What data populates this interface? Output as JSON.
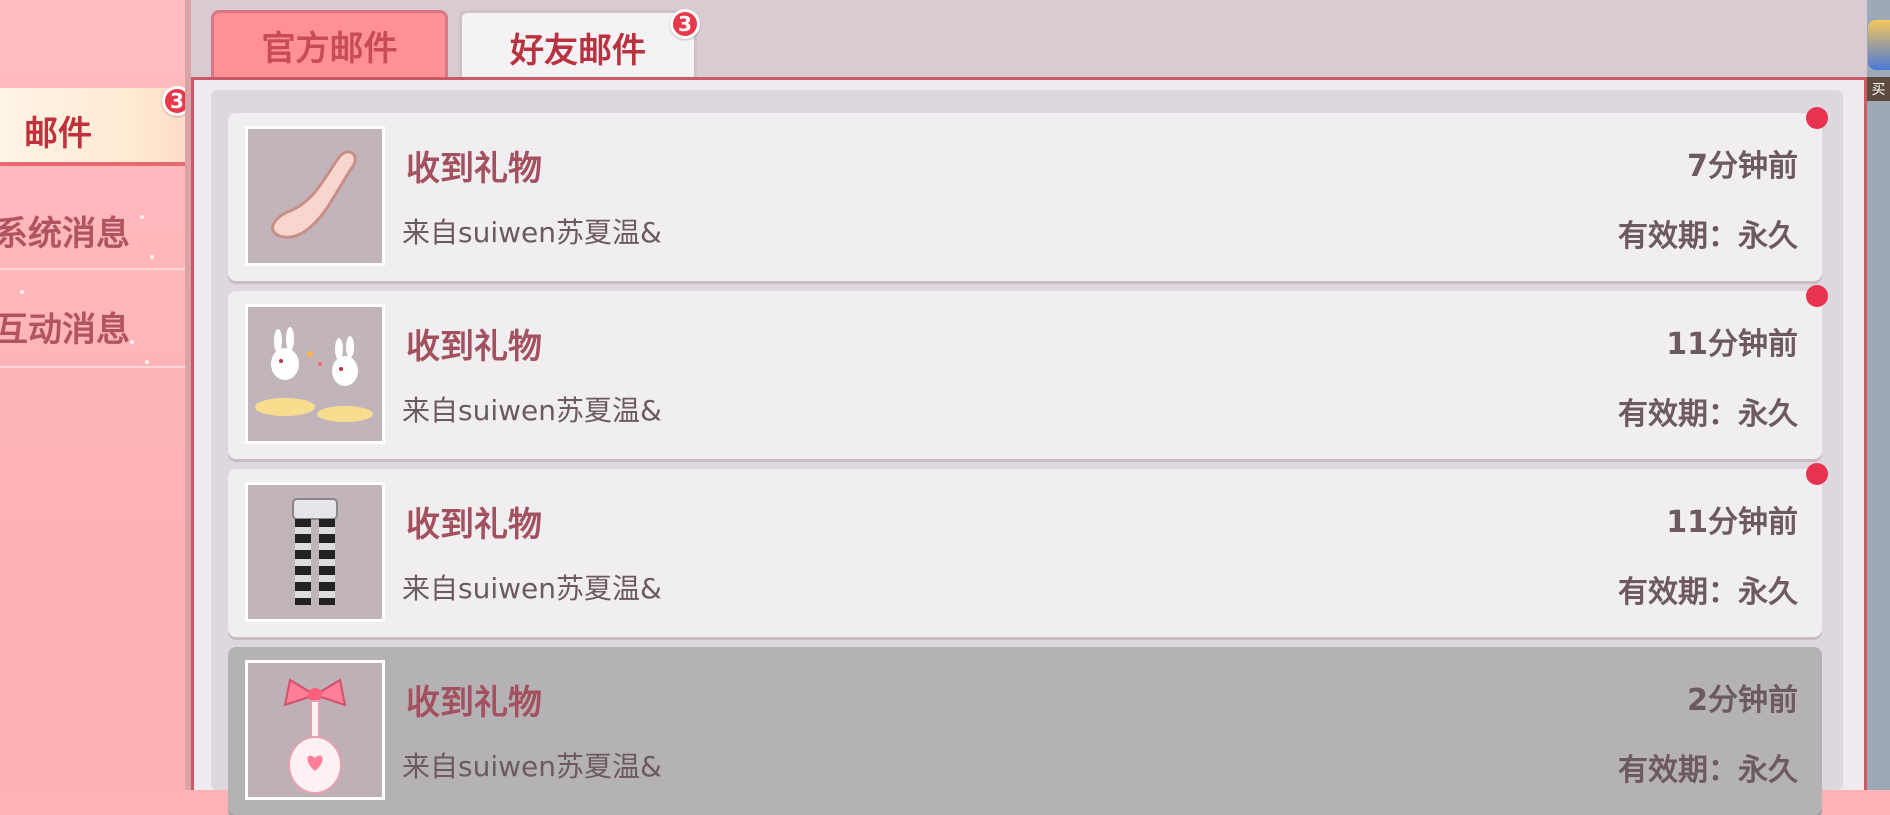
{
  "sidebar": {
    "items": [
      {
        "label": "邮件",
        "active": true,
        "badge": "3"
      },
      {
        "label": "系统消息",
        "active": false
      },
      {
        "label": "互动消息",
        "active": false
      }
    ]
  },
  "tabs": [
    {
      "label": "官方邮件",
      "active": false
    },
    {
      "label": "好友邮件",
      "active": true,
      "badge": "3"
    }
  ],
  "mails": [
    {
      "title": "收到礼物",
      "from": "来自suiwen苏夏温&",
      "time": "7分钟前",
      "expiry": "有效期：永久",
      "unread": true,
      "icon": "tail-item-icon"
    },
    {
      "title": "收到礼物",
      "from": "来自suiwen苏夏温&",
      "time": "11分钟前",
      "expiry": "有效期：永久",
      "unread": true,
      "icon": "bunny-effect-icon"
    },
    {
      "title": "收到礼物",
      "from": "来自suiwen苏夏温&",
      "time": "11分钟前",
      "expiry": "有效期：永久",
      "unread": true,
      "icon": "striped-stockings-icon"
    },
    {
      "title": "收到礼物",
      "from": "来自suiwen苏夏温&",
      "time": "2分钟前",
      "expiry": "有效期：永久",
      "unread": false,
      "icon": "bow-spoon-icon"
    }
  ],
  "edge": {
    "chip": "买"
  },
  "colors": {
    "accent": "#e8384a",
    "tab_active_text": "#b8323f",
    "title_text": "#a3505f"
  }
}
